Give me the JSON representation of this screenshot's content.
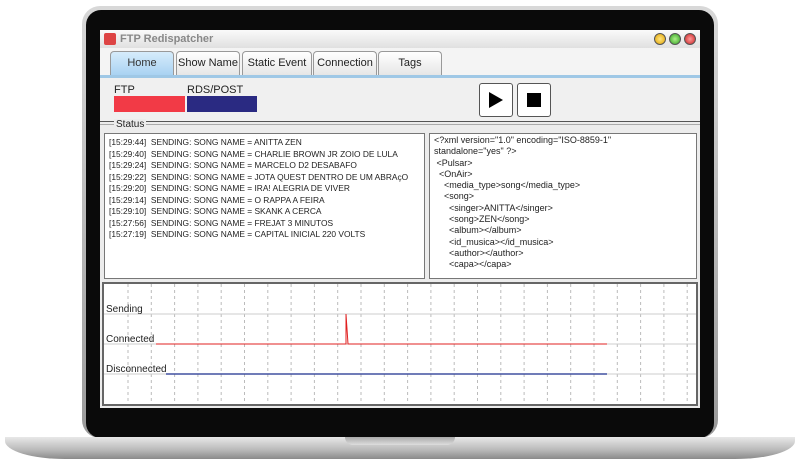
{
  "window": {
    "title": "FTP Redispatcher"
  },
  "tabs": [
    {
      "label": "Home",
      "active": true
    },
    {
      "label": "Show Name"
    },
    {
      "label": "Static Event"
    },
    {
      "label": "Connection"
    },
    {
      "label": "Tags"
    }
  ],
  "indicators": [
    {
      "label": "FTP",
      "color": "#f23a46"
    },
    {
      "label": "RDS/POST",
      "color": "#2a2a82"
    }
  ],
  "controls": {
    "play": "play-icon",
    "stop": "stop-icon"
  },
  "status": {
    "label": "Status",
    "log": [
      "[15:29:44]  SENDING: SONG NAME = ANITTA ZEN",
      "[15:29:40]  SENDING: SONG NAME = CHARLIE BROWN JR ZOIO DE LULA",
      "[15:29:24]  SENDING: SONG NAME = MARCELO D2 DESABAFO",
      "[15:29:22]  SENDING: SONG NAME = JOTA QUEST DENTRO DE UM ABRAçO",
      "[15:29:20]  SENDING: SONG NAME = IRA! ALEGRIA DE VIVER",
      "[15:29:14]  SENDING: SONG NAME = O RAPPA A FEIRA",
      "[15:29:10]  SENDING: SONG NAME = SKANK A CERCA",
      "[15:27:56]  SENDING: SONG NAME = FREJAT 3 MINUTOS",
      "[15:27:19]  SENDING: SONG NAME = CAPITAL INICIAL 220 VOLTS"
    ],
    "xml": [
      "<?xml version=\"1.0\" encoding=\"ISO-8859-1\"",
      "standalone=\"yes\" ?>",
      " <Pulsar>",
      "  <OnAir>",
      "    <media_type>song</media_type>",
      "    <song>",
      "      <singer>ANITTA</singer>",
      "      <song>ZEN</song>",
      "      <album></album>",
      "      <id_musica></id_musica>",
      "      <author></author>",
      "      <capa></capa>"
    ]
  },
  "timeline": {
    "levels": [
      "Sending",
      "Connected",
      "Disconnected"
    ],
    "colors": {
      "connected": "#e02020",
      "disconnected": "#4050a0"
    }
  }
}
